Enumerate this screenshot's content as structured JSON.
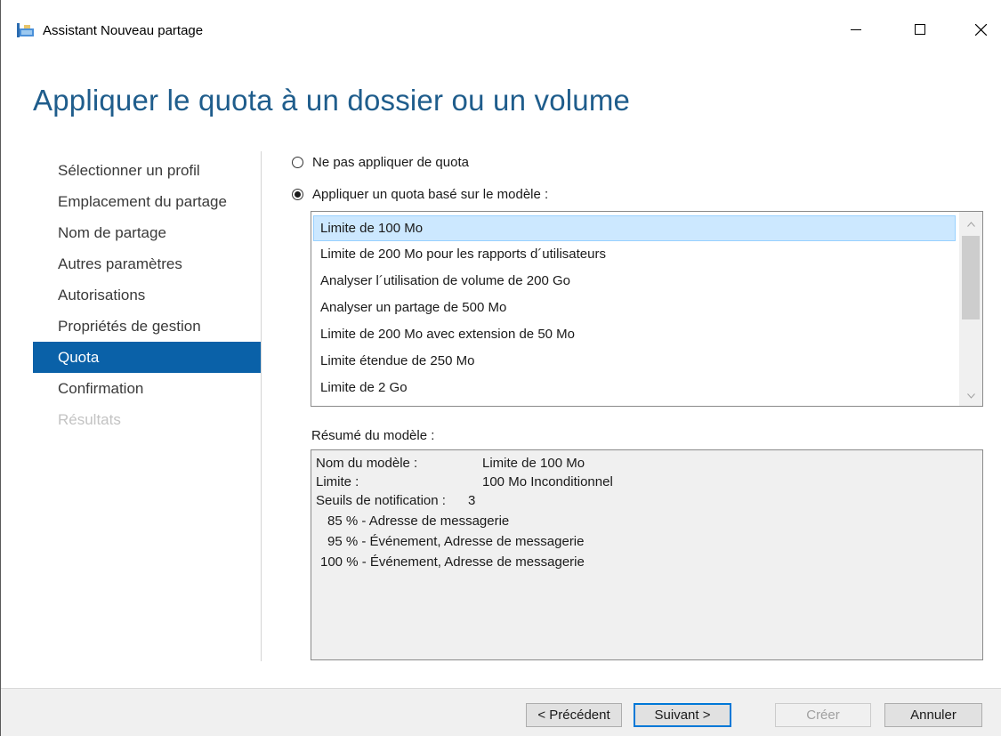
{
  "window": {
    "title": "Assistant Nouveau partage",
    "controls": [
      "minimize-icon",
      "maximize-icon",
      "close-icon"
    ]
  },
  "page_heading": "Appliquer le quota à un dossier ou un volume",
  "nav": {
    "items": [
      {
        "label": "Sélectionner un profil",
        "state": "normal"
      },
      {
        "label": "Emplacement du partage",
        "state": "normal"
      },
      {
        "label": "Nom de partage",
        "state": "normal"
      },
      {
        "label": "Autres paramètres",
        "state": "normal"
      },
      {
        "label": "Autorisations",
        "state": "normal"
      },
      {
        "label": "Propriétés de gestion",
        "state": "normal"
      },
      {
        "label": "Quota",
        "state": "active"
      },
      {
        "label": "Confirmation",
        "state": "normal"
      },
      {
        "label": "Résultats",
        "state": "disabled"
      }
    ]
  },
  "quota_options": {
    "no_quota_label": "Ne pas appliquer de quota",
    "template_quota_label": "Appliquer un quota basé sur le modèle :",
    "selected": "template"
  },
  "templates": {
    "items": [
      "Limite de 100 Mo",
      "Limite de 200 Mo pour les rapports d´utilisateurs",
      "Analyser l´utilisation de volume de 200 Go",
      "Analyser un partage de 500 Mo",
      "Limite de 200 Mo avec extension de 50 Mo",
      "Limite étendue de 250 Mo",
      "Limite de 2 Go"
    ],
    "selected_index": 0
  },
  "summary": {
    "label": "Résumé du modèle :",
    "template_name_key": "Nom du modèle :",
    "template_name_value": "Limite de 100 Mo",
    "limit_key": "Limite :",
    "limit_value": "100 Mo Inconditionnel",
    "thresholds_key": "Seuils de notification :",
    "thresholds_value": "3",
    "thresholds": [
      "85 % - Adresse de messagerie",
      "95 % - Événement, Adresse de messagerie",
      "100 % - Événement, Adresse de messagerie"
    ]
  },
  "footer": {
    "previous_label": "< Précédent",
    "next_label": "Suivant >",
    "create_label": "Créer",
    "cancel_label": "Annuler"
  },
  "colors": {
    "heading": "#1f5d8c",
    "nav_active_bg": "#0a61a8",
    "list_selected_bg": "#cce8ff",
    "default_button_border": "#0078d7"
  }
}
